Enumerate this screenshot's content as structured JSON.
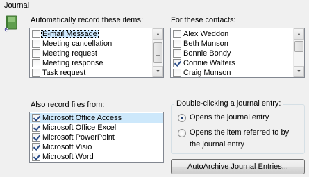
{
  "section": {
    "title": "Journal"
  },
  "icons": {
    "journal": "journal-book-icon"
  },
  "auto_record": {
    "label": "Automatically record these items:",
    "items": [
      {
        "label": "E-mail Message",
        "checked": false,
        "selected": true
      },
      {
        "label": "Meeting cancellation",
        "checked": false,
        "selected": false
      },
      {
        "label": "Meeting request",
        "checked": false,
        "selected": false
      },
      {
        "label": "Meeting response",
        "checked": false,
        "selected": false
      },
      {
        "label": "Task request",
        "checked": false,
        "selected": false
      }
    ]
  },
  "contacts": {
    "label": "For these contacts:",
    "items": [
      {
        "label": "Alex Weddon",
        "checked": false
      },
      {
        "label": "Beth Munson",
        "checked": false
      },
      {
        "label": "Bonnie Bondy",
        "checked": false
      },
      {
        "label": "Connie Walters",
        "checked": true
      },
      {
        "label": "Craig Munson",
        "checked": false
      }
    ]
  },
  "record_files": {
    "label": "Also record files from:",
    "items": [
      {
        "label": "Microsoft Office Access",
        "checked": true,
        "selected": true
      },
      {
        "label": "Microsoft Office Excel",
        "checked": true,
        "selected": false
      },
      {
        "label": "Microsoft PowerPoint",
        "checked": true,
        "selected": false
      },
      {
        "label": "Microsoft Visio",
        "checked": true,
        "selected": false
      },
      {
        "label": "Microsoft Word",
        "checked": true,
        "selected": false
      }
    ]
  },
  "double_click": {
    "legend": "Double-clicking a journal entry:",
    "option_open_entry": "Opens the journal entry",
    "option_open_item_line1": "Opens the item referred to by",
    "option_open_item_line2": "the journal entry",
    "selected": "open_entry"
  },
  "buttons": {
    "autoarchive": "AutoArchive Journal Entries..."
  }
}
